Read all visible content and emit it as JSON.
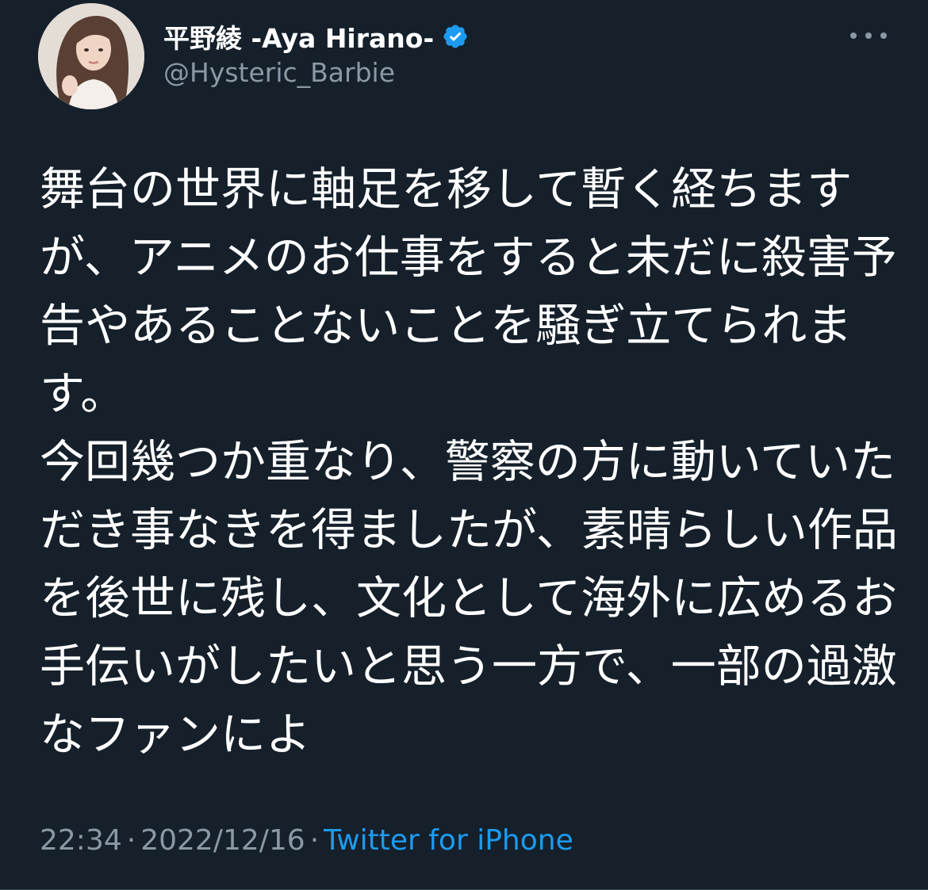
{
  "user": {
    "display_name": "平野綾 -Aya Hirano-",
    "handle": "@Hysteric_Barbie",
    "verified": true
  },
  "tweet": {
    "lines": [
      "舞台の世界に軸足を移して暫く経ちます",
      "が、アニメのお仕事をすると未だに殺害予",
      "告やあることないことを騒ぎ立てられま",
      "す。",
      "今回幾つか重なり、警察の方に動いていた",
      "だき事なきを得ましたが、素晴らしい作品",
      "を後世に残し、文化として海外に広めるお",
      "手伝いがしたいと思う一方で、一部の過激",
      "なファンによ"
    ]
  },
  "meta": {
    "time": "22:34",
    "date": "2022/12/16",
    "separator": "·",
    "source": "Twitter for iPhone"
  },
  "icons": {
    "verified": "verified-badge-icon",
    "more": "more-options-icon"
  },
  "colors": {
    "background": "#15202b",
    "text_primary": "#ffffff",
    "text_secondary": "#8b98a5",
    "accent": "#1d9bf0"
  }
}
